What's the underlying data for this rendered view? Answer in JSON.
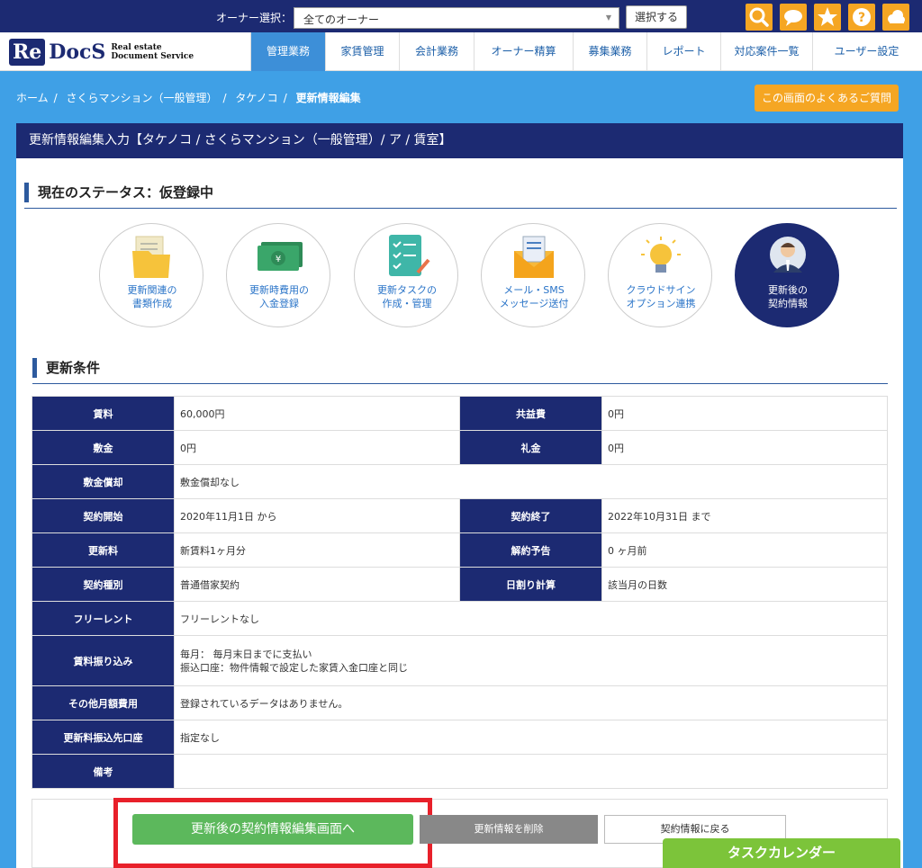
{
  "topbar": {
    "owner_label": "オーナー選択：",
    "owner_value": "全てのオーナー",
    "select_button": "選択する",
    "icons": [
      "search-icon",
      "chat-icon",
      "star-icon",
      "help-icon",
      "cloud-icon"
    ],
    "icon_color": "#f5a623"
  },
  "logo": {
    "re": "Re",
    "docs": "DocS",
    "sub1": "Real estate",
    "sub2": "Document Service"
  },
  "nav": {
    "items": [
      "管理業務",
      "家賃管理",
      "会計業務",
      "オーナー精算",
      "募集業務",
      "レポート",
      "対応案件一覧",
      "ユーザー設定"
    ],
    "active": "管理業務"
  },
  "breadcrumb": {
    "items": [
      "ホーム",
      "さくらマンション（一般管理）",
      "タケノコ",
      "更新情報編集"
    ]
  },
  "faq_button": "この画面のよくあるご質問",
  "panel_title": "更新情報編集入力【タケノコ / さくらマンション（一般管理）/ ア / 賃室】",
  "status_title": "現在のステータス：仮登録中",
  "steps": [
    {
      "line1": "更新関連の",
      "line2": "書類作成"
    },
    {
      "line1": "更新時費用の",
      "line2": "入金登録"
    },
    {
      "line1": "更新タスクの",
      "line2": "作成・管理"
    },
    {
      "line1": "メール・SMS",
      "line2": "メッセージ送付"
    },
    {
      "line1": "クラウドサイン",
      "line2": "オプション連携"
    },
    {
      "line1": "更新後の",
      "line2": "契約情報"
    }
  ],
  "conditions_title": "更新条件",
  "table": {
    "rent_label": "賃料",
    "rent": "60,000円",
    "common_label": "共益費",
    "common": "0円",
    "deposit_label": "敷金",
    "deposit": "0円",
    "key_label": "礼金",
    "key": "0円",
    "amort_label": "敷金償却",
    "amort": "敷金償却なし",
    "start_label": "契約開始",
    "start": "2020年11月1日 から",
    "end_label": "契約終了",
    "end": "2022年10月31日 まで",
    "renew_fee_label": "更新料",
    "renew_fee": "新賃料1ヶ月分",
    "notice_label": "解約予告",
    "notice": "0 ヶ月前",
    "type_label": "契約種別",
    "type": "普通借家契約",
    "daily_label": "日割り計算",
    "daily": "該当月の日数",
    "free_label": "フリーレント",
    "free": "フリーレントなし",
    "transfer_label": "賃料振り込み",
    "transfer1": "毎月： 毎月末日までに支払い",
    "transfer2": "振込口座：物件情報で設定した家賃入金口座と同じ",
    "other_label": "その他月額費用",
    "other": "登録されているデータはありません。",
    "renew_account_label": "更新料振込先口座",
    "renew_account": "指定なし",
    "remarks_label": "備考",
    "remarks": ""
  },
  "buttons": {
    "edit": "更新後の契約情報編集画面へ",
    "delete": "更新情報を削除",
    "back": "契約情報に戻る"
  },
  "task_calendar": "タスクカレンダー"
}
